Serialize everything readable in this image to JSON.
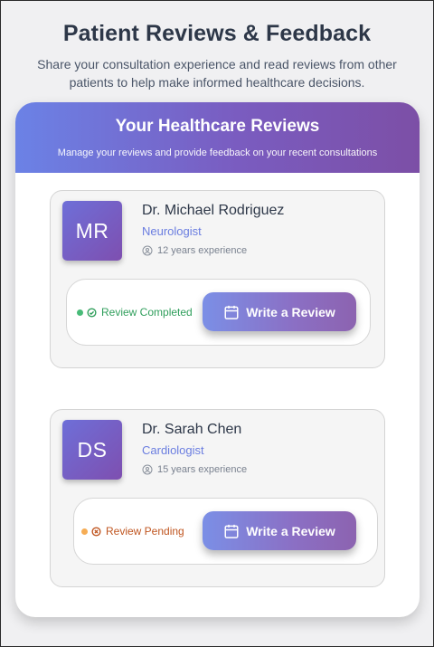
{
  "header": {
    "title": "Patient Reviews & Feedback",
    "subtitle": "Share your consultation experience and read reviews from other patients to help make informed healthcare decisions."
  },
  "panel": {
    "title": "Your Healthcare Reviews",
    "subtitle": "Manage your reviews and provide feedback on your recent consultations"
  },
  "doctors": [
    {
      "initials": "MR",
      "name": "Dr. Michael Rodriguez",
      "specialty": "Neurologist",
      "experience": "12 years experience",
      "status": "Review Completed",
      "status_color": "#2f9e5b",
      "dot_color": "#48bb78",
      "button_label": "Write a Review"
    },
    {
      "initials": "DS",
      "name": "Dr. Sarah Chen",
      "specialty": "Cardiologist",
      "experience": "15 years experience",
      "status": "Review Pending",
      "status_color": "#c05621",
      "dot_color": "#f6ad55",
      "button_label": "Write a Review"
    }
  ],
  "colors": {
    "accent": "#6a7de0",
    "gradient_start": "#6b82e6",
    "gradient_end": "#7c4fa6"
  },
  "icons": {
    "experience": "user-circle-icon",
    "completed": "check-circle-icon",
    "pending": "x-circle-icon",
    "button": "calendar-icon"
  }
}
